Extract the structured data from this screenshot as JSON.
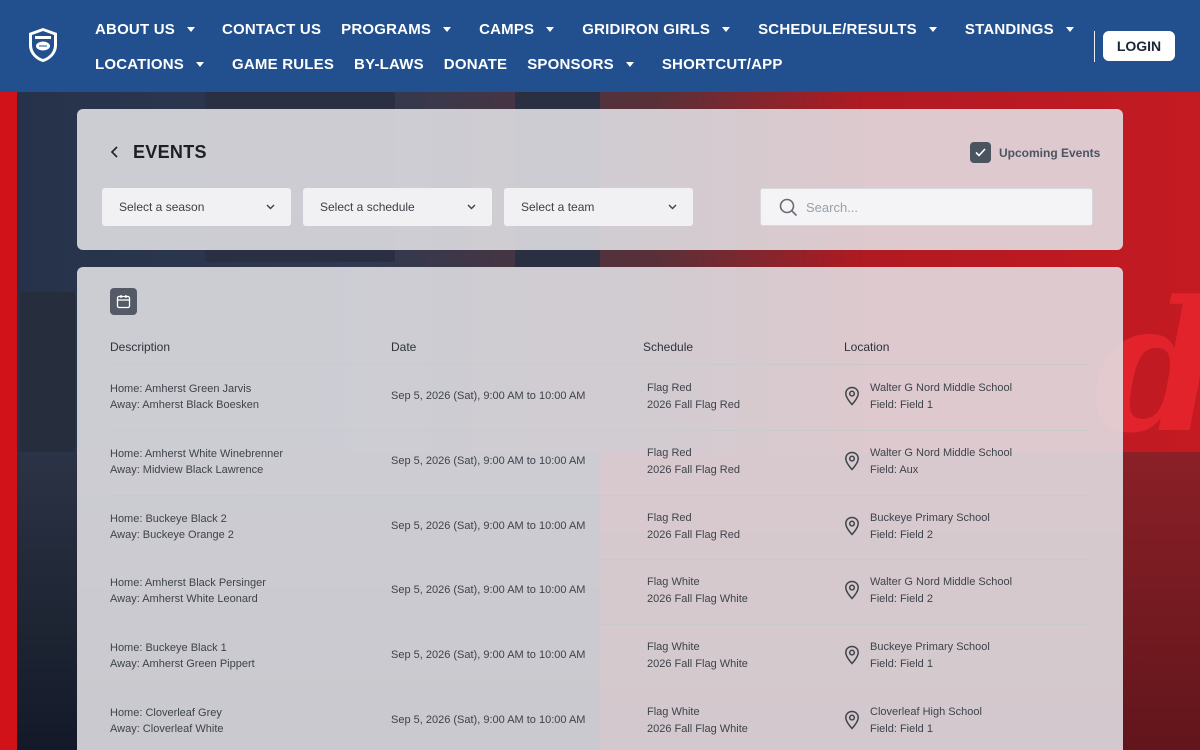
{
  "header": {
    "nav_row1": [
      {
        "label": "ABOUT US",
        "dropdown": true
      },
      {
        "label": "CONTACT US",
        "dropdown": false
      },
      {
        "label": "PROGRAMS",
        "dropdown": true
      },
      {
        "label": "CAMPS",
        "dropdown": true
      },
      {
        "label": "GRIDIRON GIRLS",
        "dropdown": true
      },
      {
        "label": "SCHEDULE/RESULTS",
        "dropdown": true
      },
      {
        "label": "STANDINGS",
        "dropdown": true
      }
    ],
    "nav_row2": [
      {
        "label": "LOCATIONS",
        "dropdown": true
      },
      {
        "label": "GAME RULES",
        "dropdown": false
      },
      {
        "label": "BY-LAWS",
        "dropdown": false
      },
      {
        "label": "DONATE",
        "dropdown": false
      },
      {
        "label": "SPONSORS",
        "dropdown": true
      },
      {
        "label": "SHORTCUT/APP",
        "dropdown": false
      }
    ],
    "login_label": "LOGIN",
    "colors": {
      "bar": "#22508f",
      "text": "#ffffff"
    }
  },
  "filters": {
    "title": "EVENTS",
    "upcoming_label": "Upcoming Events",
    "upcoming_checked": true,
    "season_placeholder": "Select a season",
    "schedule_placeholder": "Select a schedule",
    "team_placeholder": "Select a team",
    "search_placeholder": "Search..."
  },
  "table": {
    "headers": {
      "description": "Description",
      "date": "Date",
      "schedule": "Schedule",
      "location": "Location"
    },
    "rows": [
      {
        "home": "Home: Amherst Green Jarvis",
        "away": "Away: Amherst Black Boesken",
        "date": "Sep 5, 2026 (Sat), 9:00 AM to 10:00 AM",
        "division": "Flag Red",
        "schedule": "2026 Fall Flag Red",
        "location": "Walter G Nord Middle School",
        "field": "Field: Field 1"
      },
      {
        "home": "Home: Amherst White Winebrenner",
        "away": "Away: Midview Black Lawrence",
        "date": "Sep 5, 2026 (Sat), 9:00 AM to 10:00 AM",
        "division": "Flag Red",
        "schedule": "2026 Fall Flag Red",
        "location": "Walter G Nord Middle School",
        "field": "Field: Aux"
      },
      {
        "home": "Home: Buckeye Black 2",
        "away": "Away: Buckeye Orange 2",
        "date": "Sep 5, 2026 (Sat), 9:00 AM to 10:00 AM",
        "division": "Flag Red",
        "schedule": "2026 Fall Flag Red",
        "location": "Buckeye Primary School",
        "field": "Field: Field 2"
      },
      {
        "home": "Home: Amherst Black Persinger",
        "away": "Away: Amherst White Leonard",
        "date": "Sep 5, 2026 (Sat), 9:00 AM to 10:00 AM",
        "division": "Flag White",
        "schedule": "2026 Fall Flag White",
        "location": "Walter G Nord Middle School",
        "field": "Field: Field 2"
      },
      {
        "home": "Home: Buckeye Black 1",
        "away": "Away: Amherst Green Pippert",
        "date": "Sep 5, 2026 (Sat), 9:00 AM to 10:00 AM",
        "division": "Flag White",
        "schedule": "2026 Fall Flag White",
        "location": "Buckeye Primary School",
        "field": "Field: Field 1"
      },
      {
        "home": "Home: Cloverleaf Grey",
        "away": "Away: Cloverleaf White",
        "date": "Sep 5, 2026 (Sat), 9:00 AM to 10:00 AM",
        "division": "Flag White",
        "schedule": "2026 Fall Flag White",
        "location": "Cloverleaf High School",
        "field": "Field: Field 1"
      }
    ]
  }
}
